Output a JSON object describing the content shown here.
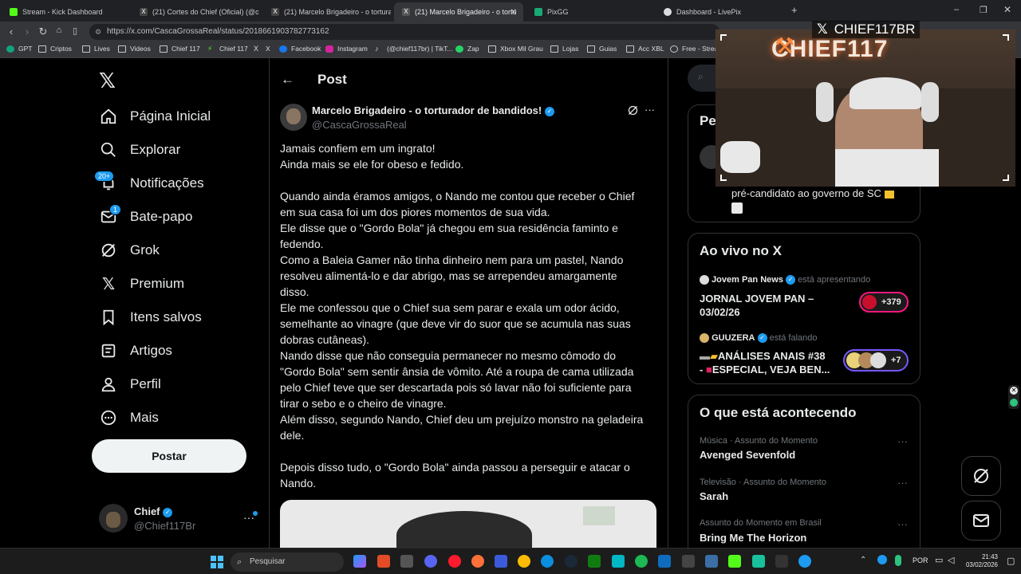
{
  "browser": {
    "tabs": [
      {
        "label": "Stream - Kick Dashboard",
        "color": "#53fc18"
      },
      {
        "label": "(21) Cortes do Chief (Oficial) (@corte",
        "color": "#e7e9ea"
      },
      {
        "label": "(21) Marcelo Brigadeiro - o torturad",
        "color": "#e7e9ea"
      },
      {
        "label": "(21) Marcelo Brigadeiro - o tortu",
        "color": "#e7e9ea"
      },
      {
        "label": "PixGG",
        "color": "#19a974"
      },
      {
        "label": "Dashboard - LivePix",
        "color": "#dadce0"
      }
    ],
    "url": "https://x.com/CascaGrossaReal/status/2018661903782773162",
    "bookmarks": [
      "GPT",
      "Criptos",
      "Lives",
      "Videos",
      "Chief 117",
      "Chief 117",
      "X",
      "Facebook",
      "Instagram",
      "(@chief117br) | TikT...",
      "Zap",
      "Xbox Mil Grau",
      "Lojas",
      "Guias",
      "Acc XBL",
      "Free - Strea"
    ]
  },
  "sidebar": {
    "items": [
      {
        "label": "Página Inicial",
        "icon": "home-icon"
      },
      {
        "label": "Explorar",
        "icon": "search-icon"
      },
      {
        "label": "Notificações",
        "icon": "bell-icon",
        "badge": "20+"
      },
      {
        "label": "Bate-papo",
        "icon": "mail-icon",
        "badge": "1"
      },
      {
        "label": "Grok",
        "icon": "grok-icon"
      },
      {
        "label": "Premium",
        "icon": "x-icon"
      },
      {
        "label": "Itens salvos",
        "icon": "bookmark-icon"
      },
      {
        "label": "Artigos",
        "icon": "article-icon"
      },
      {
        "label": "Perfil",
        "icon": "person-icon"
      },
      {
        "label": "Mais",
        "icon": "more-icon"
      }
    ],
    "post_button": "Postar",
    "account": {
      "name": "Chief",
      "handle": "@Chief117Br"
    }
  },
  "post": {
    "header_title": "Post",
    "author_name": "Marcelo Brigadeiro - o torturador de bandidos!",
    "author_handle": "@CascaGrossaReal",
    "lines": [
      "Jamais confiem em um ingrato!",
      "Ainda mais se ele for obeso e fedido.",
      "",
      "Quando ainda éramos amigos, o Nando me contou que receber o Chief",
      "em sua casa foi um dos piores momentos de sua vida.",
      "Ele disse que o \"Gordo Bola\" já chegou em sua residência faminto e",
      "fedendo.",
      "Como a Baleia Gamer não tinha dinheiro nem para um pastel, Nando",
      "resolveu alimentá-lo e dar abrigo, mas se arrependeu amargamente",
      "disso.",
      "Ele me confessou que o Chief sua sem parar e exala um odor ácido,",
      "semelhante ao vinagre (que deve vir do suor que se acumula nas suas",
      "dobras cutâneas).",
      "Nando disse que não conseguia permanecer no mesmo cômodo do",
      "\"Gordo Bola\" sem sentir ânsia de vômito. Até a roupa de cama utilizada",
      "pelo Chief teve que ser descartada pois só lavar não foi suficiente para",
      "tirar o sebo e o cheiro de vinagre.",
      "Além disso, segundo Nando, Chief deu um prejuízo monstro na geladeira",
      "dele.",
      "",
      "Depois disso tudo, o \"Gordo Bola\" ainda passou a perseguir e atacar o",
      "Nando."
    ]
  },
  "right": {
    "search_partial": "",
    "people_partial_title": "Pe",
    "people_partial_line": "pré-candidato ao governo de SC",
    "live": {
      "title": "Ao vivo no X",
      "items": [
        {
          "host": "Jovem Pan News",
          "status": "está apresentando",
          "title1": "JORNAL JOVEM PAN –",
          "title2": "03/02/26",
          "count": "+379"
        },
        {
          "host": "GUUZERA",
          "status": "está falando",
          "title1": "ANÁLISES ANAIS #38",
          "title2": "ESPECIAL, VEJA BEN...",
          "count": "+7"
        }
      ]
    },
    "trends": {
      "title": "O que está acontecendo",
      "items": [
        {
          "context": "Música · Assunto do Momento",
          "name": "Avenged Sevenfold"
        },
        {
          "context": "Televisão · Assunto do Momento",
          "name": "Sarah"
        },
        {
          "context": "Assunto do Momento em Brasil",
          "name": "Bring Me The Horizon"
        }
      ]
    }
  },
  "webcam": {
    "overlay_text": "CHIEF117BR",
    "sign_text": "CHIEF117"
  },
  "taskbar": {
    "search_placeholder": "Pesquisar",
    "lang": "POR",
    "time": "21:43",
    "date": "03/02/2026"
  }
}
